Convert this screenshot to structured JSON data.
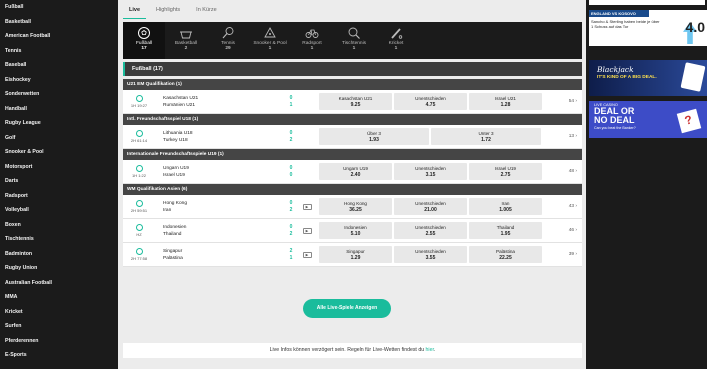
{
  "sidebar": {
    "items": [
      "Fußball",
      "Basketball",
      "American Football",
      "Tennis",
      "Baseball",
      "Eishockey",
      "Sonderwetten",
      "Handball",
      "Rugby League",
      "Golf",
      "Snooker & Pool",
      "Motorsport",
      "Darts",
      "Radsport",
      "Volleyball",
      "Boxen",
      "Tischtennis",
      "Badminton",
      "Rugby Union",
      "Australian Football",
      "MMA",
      "Kricket",
      "Surfen",
      "Pferderennen",
      "E-Sports"
    ]
  },
  "tabs": [
    "Live",
    "Highlights",
    "In Kürze"
  ],
  "sports": [
    {
      "name": "Fußball",
      "count": "17",
      "icon": "soccer-ball-icon"
    },
    {
      "name": "Basketball",
      "count": "2",
      "icon": "basketball-icon"
    },
    {
      "name": "Tennis",
      "count": "29",
      "icon": "tennis-racket-icon"
    },
    {
      "name": "Snooker & Pool",
      "count": "1",
      "icon": "snooker-icon"
    },
    {
      "name": "Radsport",
      "count": "1",
      "icon": "bicycle-icon"
    },
    {
      "name": "Tischtennis",
      "count": "1",
      "icon": "table-tennis-icon"
    },
    {
      "name": "Kricket",
      "count": "1",
      "icon": "cricket-icon"
    }
  ],
  "section_title": "Fußball (17)",
  "leagues": [
    {
      "name": "U21 EM Qualifikation (1)",
      "matches": [
        {
          "clock": "1H 19:27",
          "home": "Kasachstan U21",
          "away": "Rumänien U21",
          "score_home": "0",
          "score_away": "1",
          "tv": false,
          "odds": [
            {
              "label": "Kasachstan U21",
              "price": "9.25"
            },
            {
              "label": "Unentschieden",
              "price": "4.75"
            },
            {
              "label": "Israel U21",
              "price": "1.28"
            }
          ],
          "more": "54 ›"
        }
      ]
    },
    {
      "name": "Intl. Freundschaftsspiel U18 (1)",
      "matches": [
        {
          "clock": "2H 61:14",
          "home": "Lithuania U18",
          "away": "Turkey U18",
          "score_home": "0",
          "score_away": "2",
          "tv": false,
          "odds": [
            {
              "label": "Über 3",
              "price": "1.93"
            },
            {
              "label": "Unter 3",
              "price": "1.72"
            }
          ],
          "more": "13 ›"
        }
      ]
    },
    {
      "name": "Internationale Freundschaftsspiele U19 (1)",
      "matches": [
        {
          "clock": "1H 1:22",
          "home": "Ungarn U19",
          "away": "Israel U19",
          "score_home": "0",
          "score_away": "0",
          "tv": false,
          "odds": [
            {
              "label": "Ungarn U19",
              "price": "2.40"
            },
            {
              "label": "Unentschieden",
              "price": "3.15"
            },
            {
              "label": "Israel U19",
              "price": "2.75"
            }
          ],
          "more": "48 ›"
        }
      ]
    },
    {
      "name": "WM Qualifikation Asien (6)",
      "matches": [
        {
          "clock": "2H 59:51",
          "home": "Hong Kong",
          "away": "Iran",
          "score_home": "0",
          "score_away": "2",
          "tv": true,
          "odds": [
            {
              "label": "Hong Kong",
              "price": "36.25"
            },
            {
              "label": "Unentschieden",
              "price": "21.00"
            },
            {
              "label": "Iran",
              "price": "1.005"
            }
          ],
          "more": "43 ›"
        },
        {
          "clock": "HZ",
          "home": "Indonesien",
          "away": "Thailand",
          "score_home": "0",
          "score_away": "2",
          "tv": true,
          "odds": [
            {
              "label": "Indonesien",
              "price": "5.10"
            },
            {
              "label": "Unentschieden",
              "price": "2.55"
            },
            {
              "label": "Thailand",
              "price": "1.95"
            }
          ],
          "more": "46 ›"
        },
        {
          "clock": "2H 77:58",
          "home": "Singapur",
          "away": "Palästina",
          "score_home": "2",
          "score_away": "1",
          "tv": true,
          "odds": [
            {
              "label": "Singapur",
              "price": "1.29"
            },
            {
              "label": "Unentschieden",
              "price": "3.55"
            },
            {
              "label": "Palästina",
              "price": "22.25"
            }
          ],
          "more": "39 ›"
        }
      ]
    }
  ],
  "all_live_button": "Alle Live-Spiele Anzeigen",
  "info_text": "Live Infos können verzögert sein. Regeln für Live-Wetten findest du ",
  "info_link": "hier",
  "info_end": ".",
  "ads": {
    "ad1_header": "ENGLAND VS KOSOVO",
    "ad1_text": "Sancho & Sterling haben beide je über 1 Schuss auf das Tor",
    "ad1_big": "4.0",
    "ad2_title": "Blackjack",
    "ad2_sub": "IT'S KIND OF A BIG DEAL.",
    "ad3_top": "LIVE CASINO",
    "ad3_deal1": "DEAL OR",
    "ad3_deal2": "NO DEAL",
    "ad3_sub": "Can you beat the Banker?"
  },
  "colors": {
    "accent": "#1abc9c",
    "dark": "#1b1b1b",
    "header": "#454545"
  }
}
